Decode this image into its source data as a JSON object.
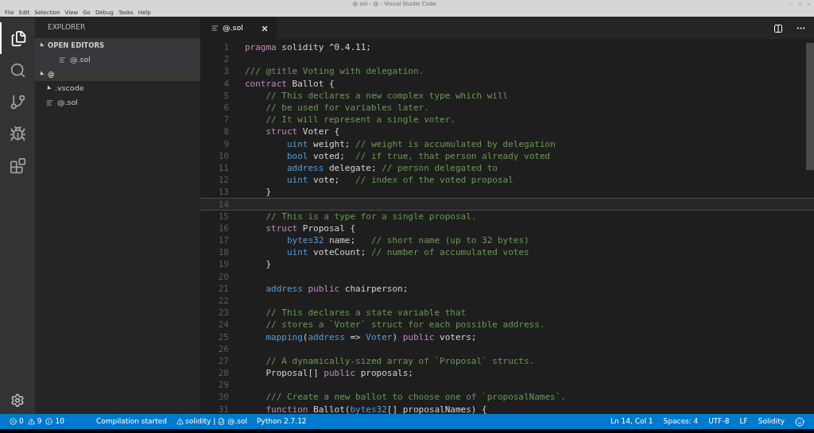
{
  "window": {
    "title": "@.sol - @ - Visual Studio Code"
  },
  "menu": [
    "File",
    "Edit",
    "Selection",
    "View",
    "Go",
    "Debug",
    "Tasks",
    "Help"
  ],
  "activity_bar": [
    {
      "kind": "files",
      "selected": true
    },
    {
      "kind": "search",
      "selected": false
    },
    {
      "kind": "git",
      "selected": false
    },
    {
      "kind": "debug",
      "selected": false
    },
    {
      "kind": "extensions",
      "selected": false
    }
  ],
  "sidebar": {
    "title": "EXPLORER",
    "sections": [
      {
        "label": "OPEN EDITORS",
        "expanded": true,
        "children": [
          {
            "label": "@.sol",
            "kind": "file",
            "selected": true
          }
        ]
      },
      {
        "label": "@",
        "expanded": true,
        "children": [
          {
            "label": ".vscode",
            "kind": "folder",
            "expanded": true,
            "selected": false
          },
          {
            "label": "@.sol",
            "kind": "file",
            "selected": false
          }
        ]
      }
    ]
  },
  "tabs": [
    {
      "label": "@.sol",
      "selected": true
    }
  ],
  "editor": {
    "lines": [
      {
        "number": "1",
        "current": false,
        "tokens": [
          {
            "kind": "keyword",
            "text": "pragma"
          },
          {
            "kind": "plain",
            "text": " solidity ^0.4.11;"
          }
        ]
      },
      {
        "number": "2",
        "current": false
      },
      {
        "number": "3",
        "current": false,
        "tokens": [
          {
            "kind": "comment",
            "text": "/// @title Voting with delegation."
          }
        ]
      },
      {
        "number": "4",
        "current": false,
        "tokens": [
          {
            "kind": "keyword",
            "text": "contract"
          },
          {
            "kind": "plain",
            "text": " Ballot {"
          }
        ]
      },
      {
        "number": "5",
        "current": false,
        "tokens": [
          {
            "kind": "comment",
            "text": "    // This declares a new complex type which will"
          }
        ]
      },
      {
        "number": "6",
        "current": false,
        "tokens": [
          {
            "kind": "comment",
            "text": "    // be used for variables later."
          }
        ]
      },
      {
        "number": "7",
        "current": false,
        "tokens": [
          {
            "kind": "comment",
            "text": "    // It will represent a single voter."
          }
        ]
      },
      {
        "number": "8",
        "current": false,
        "tokens": [
          {
            "kind": "keyword",
            "text": "    struct"
          },
          {
            "kind": "plain",
            "text": " Voter {"
          }
        ]
      },
      {
        "number": "9",
        "current": false,
        "tokens": [
          {
            "kind": "type",
            "text": "        uint"
          },
          {
            "kind": "plain",
            "text": " weight; "
          },
          {
            "kind": "comment",
            "text": "// weight is accumulated by delegation"
          }
        ]
      },
      {
        "number": "10",
        "current": false,
        "tokens": [
          {
            "kind": "type",
            "text": "        bool"
          },
          {
            "kind": "plain",
            "text": " voted;  "
          },
          {
            "kind": "comment",
            "text": "// if true, that person already voted"
          }
        ]
      },
      {
        "number": "11",
        "current": false,
        "tokens": [
          {
            "kind": "type",
            "text": "        address"
          },
          {
            "kind": "plain",
            "text": " delegate; "
          },
          {
            "kind": "comment",
            "text": "// person delegated to"
          }
        ]
      },
      {
        "number": "12",
        "current": false,
        "tokens": [
          {
            "kind": "type",
            "text": "        uint"
          },
          {
            "kind": "plain",
            "text": " vote;   "
          },
          {
            "kind": "comment",
            "text": "// index of the voted proposal"
          }
        ]
      },
      {
        "number": "13",
        "current": false,
        "tokens": [
          {
            "kind": "plain",
            "text": "    }"
          }
        ]
      },
      {
        "number": "14",
        "current": true
      },
      {
        "number": "15",
        "current": false,
        "tokens": [
          {
            "kind": "comment",
            "text": "    // This is a type for a single proposal."
          }
        ]
      },
      {
        "number": "16",
        "current": false,
        "tokens": [
          {
            "kind": "keyword",
            "text": "    struct"
          },
          {
            "kind": "plain",
            "text": " Proposal {"
          }
        ]
      },
      {
        "number": "17",
        "current": false,
        "tokens": [
          {
            "kind": "type",
            "text": "        bytes32"
          },
          {
            "kind": "plain",
            "text": " name;   "
          },
          {
            "kind": "comment",
            "text": "// short name (up to 32 bytes)"
          }
        ]
      },
      {
        "number": "18",
        "current": false,
        "tokens": [
          {
            "kind": "type",
            "text": "        uint"
          },
          {
            "kind": "plain",
            "text": " voteCount; "
          },
          {
            "kind": "comment",
            "text": "// number of accumulated votes"
          }
        ]
      },
      {
        "number": "19",
        "current": false,
        "tokens": [
          {
            "kind": "plain",
            "text": "    }"
          }
        ]
      },
      {
        "number": "20",
        "current": false
      },
      {
        "number": "21",
        "current": false,
        "tokens": [
          {
            "kind": "type",
            "text": "    address"
          },
          {
            "kind": "keyword",
            "text": " public"
          },
          {
            "kind": "plain",
            "text": " chairperson;"
          }
        ]
      },
      {
        "number": "22",
        "current": false
      },
      {
        "number": "23",
        "current": false,
        "tokens": [
          {
            "kind": "comment",
            "text": "    // This declares a state variable that"
          }
        ]
      },
      {
        "number": "24",
        "current": false,
        "tokens": [
          {
            "kind": "comment",
            "text": "    // stores a `Voter` struct for each possible address."
          }
        ]
      },
      {
        "number": "25",
        "current": false,
        "tokens": [
          {
            "kind": "type",
            "text": "    mapping"
          },
          {
            "kind": "plain",
            "text": "("
          },
          {
            "kind": "type",
            "text": "address"
          },
          {
            "kind": "plain",
            "text": " => "
          },
          {
            "kind": "type",
            "text": "Voter"
          },
          {
            "kind": "plain",
            "text": ") "
          },
          {
            "kind": "keyword",
            "text": "public"
          },
          {
            "kind": "plain",
            "text": " voters;"
          }
        ]
      },
      {
        "number": "26",
        "current": false
      },
      {
        "number": "27",
        "current": false,
        "tokens": [
          {
            "kind": "comment",
            "text": "    // A dynamically-sized array of `Proposal` structs."
          }
        ]
      },
      {
        "number": "28",
        "current": false,
        "tokens": [
          {
            "kind": "plain",
            "text": "    Proposal[] "
          },
          {
            "kind": "keyword",
            "text": "public"
          },
          {
            "kind": "plain",
            "text": " proposals;"
          }
        ]
      },
      {
        "number": "29",
        "current": false
      },
      {
        "number": "30",
        "current": false,
        "tokens": [
          {
            "kind": "comment",
            "text": "    /// Create a new ballot to choose one of `proposalNames`."
          }
        ]
      },
      {
        "number": "31",
        "current": false,
        "tokens": [
          {
            "kind": "keyword",
            "text": "    function"
          },
          {
            "kind": "plain",
            "text": " Ballot("
          },
          {
            "kind": "type",
            "text": "bytes32"
          },
          {
            "kind": "plain",
            "text": "[] proposalNames) {"
          }
        ]
      }
    ]
  },
  "status_bar": {
    "errors": "0",
    "warnings": "9",
    "infos": "10",
    "left": [
      "Compilation started"
    ],
    "solidity": "solidity",
    "separator": "|",
    "file": "@.sol",
    "python": "Python 2.7.12",
    "right": [
      "Ln 14, Col 1",
      "Spaces: 4",
      "UTF-8",
      "LF",
      "Solidity"
    ]
  }
}
